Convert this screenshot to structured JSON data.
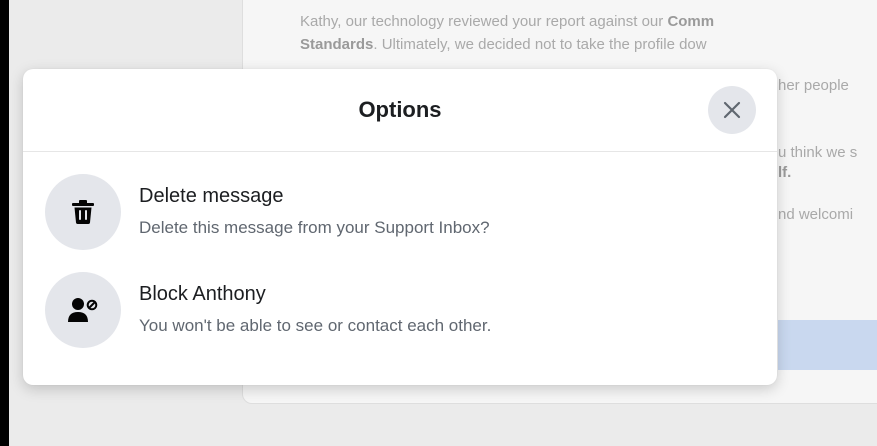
{
  "background": {
    "line1_text": "Kathy, our technology reviewed your report against our ",
    "line1_bold": "Comm",
    "line2_bold": "Standards",
    "line2_text": ". Ultimately, we decided not to take the profile dow",
    "line3": "her people",
    "line4": "u think we s",
    "line5": "lf.",
    "line6": "nd welcomi"
  },
  "modal": {
    "title": "Options",
    "close_icon": "close-icon",
    "options": [
      {
        "icon": "trash-icon",
        "title": "Delete message",
        "subtitle": "Delete this message from your Support Inbox?"
      },
      {
        "icon": "block-user-icon",
        "title": "Block Anthony",
        "subtitle": "You won't be able to see or contact each other."
      }
    ]
  },
  "colors": {
    "icon_circle": "#e4e6eb",
    "title_text": "#1c1e21",
    "subtitle_text": "#606770",
    "backdrop": "#ebebeb"
  }
}
